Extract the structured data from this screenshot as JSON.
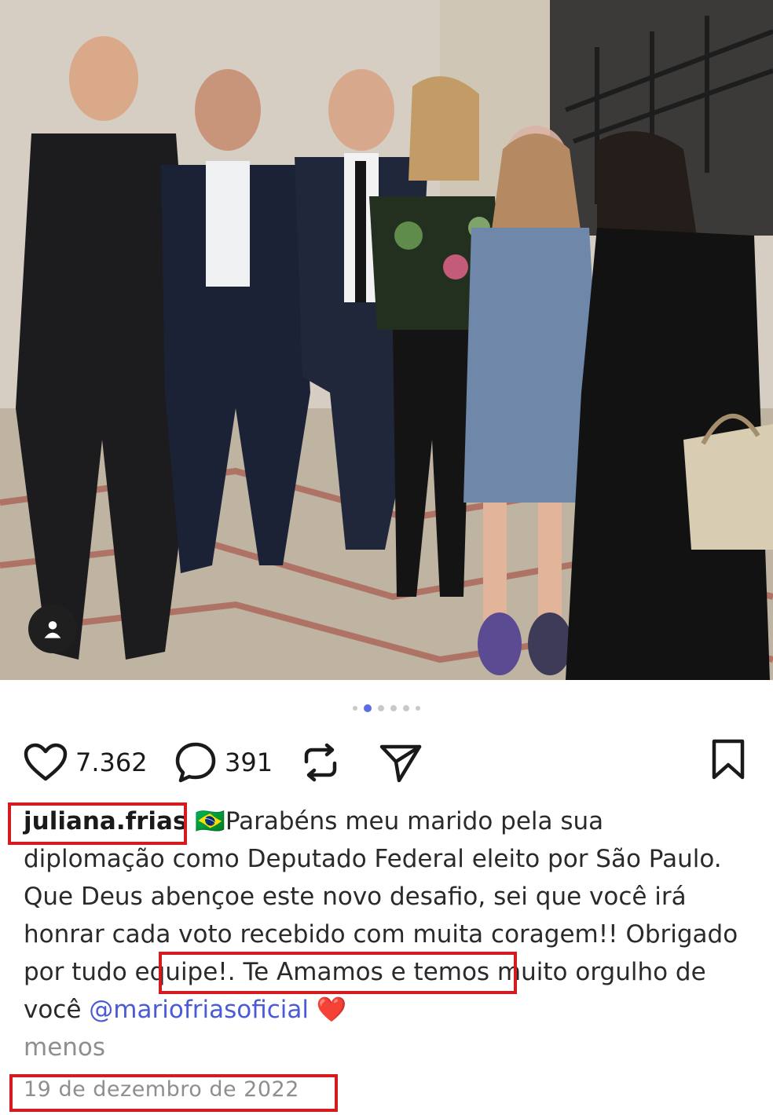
{
  "post": {
    "photo": {
      "tagged_icon": "person-icon"
    },
    "carousel": {
      "count": 6,
      "active_index": 1
    },
    "actions": {
      "likes": "7.362",
      "comments": "391",
      "like_icon": "heart-icon",
      "comment_icon": "comment-bubble-icon",
      "repost_icon": "repost-icon",
      "share_icon": "send-icon",
      "save_icon": "bookmark-icon"
    },
    "caption": {
      "username": "juliana.frias",
      "flag": "🇧🇷",
      "text_part1": "Parabéns meu marido pela sua diplomação como Deputado Federal eleito por São Paulo. Que Deus abençoe este novo desafio, sei que você irá honrar cada voto recebido com muita coragem!! ",
      "highlighted_phrase": "Obrigado por tudo equipe!",
      "text_part2": ". Te Amamos e temos muito orgulho de você ",
      "mention": "@mariofriasoficial",
      "heart": "❤️",
      "more_label": "menos"
    },
    "date": "19 de dezembro de 2022",
    "colors": {
      "highlight_box": "#d71a20",
      "mention": "#4a5bd6",
      "active_dot": "#5b6ee1"
    }
  }
}
